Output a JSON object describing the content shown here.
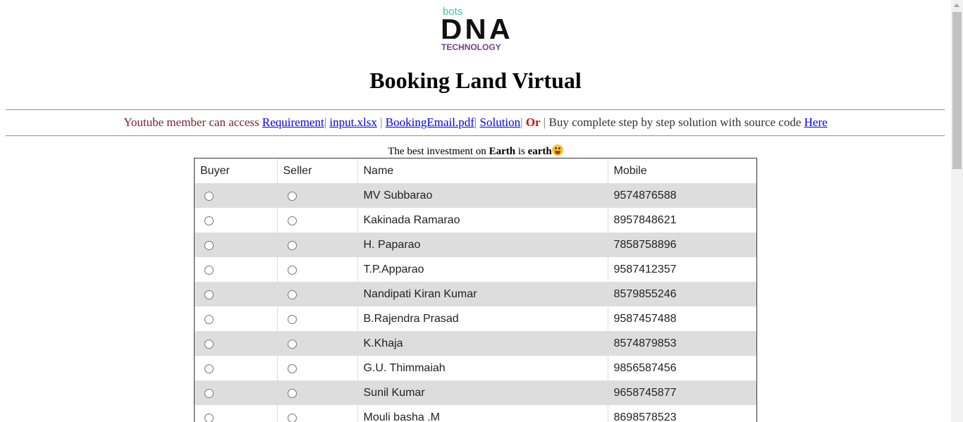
{
  "logo": {
    "top_text": "bots",
    "main_text": "DNA",
    "bottom_text": "TECHNOLOGY"
  },
  "title": "Booking Land Virtual",
  "linkbar": {
    "intro": "Youtube member can access",
    "links": [
      {
        "label": "Requirement"
      },
      {
        "label": "input.xlsx"
      },
      {
        "label": "BookingEmail.pdf"
      },
      {
        "label": "Solution"
      }
    ],
    "or_text": "Or",
    "buy_text": "Buy complete step by step solution with source code",
    "buy_link": "Here"
  },
  "tagline": {
    "prefix": "The best investment on",
    "bold1": "Earth",
    "middle": "is",
    "bold2": "earth"
  },
  "table": {
    "headers": {
      "buyer": "Buyer",
      "seller": "Seller",
      "name": "Name",
      "mobile": "Mobile"
    },
    "rows": [
      {
        "name": "MV Subbarao",
        "mobile": "9574876588"
      },
      {
        "name": "Kakinada Ramarao",
        "mobile": "8957848621"
      },
      {
        "name": "H. Paparao",
        "mobile": "7858758896"
      },
      {
        "name": "T.P.Apparao",
        "mobile": "9587412357"
      },
      {
        "name": "Nandipati Kiran Kumar",
        "mobile": "8579855246"
      },
      {
        "name": "B.Rajendra Prasad",
        "mobile": "9587457488"
      },
      {
        "name": "K.Khaja",
        "mobile": "8574879853"
      },
      {
        "name": "G.U. Thimmaiah",
        "mobile": "9856587456"
      },
      {
        "name": "Sunil Kumar",
        "mobile": "9658745877"
      },
      {
        "name": "Mouli basha .M",
        "mobile": "8698578523"
      }
    ]
  },
  "colors": {
    "row_shade": "#dddddd",
    "link": "#0000ee",
    "or_red": "#cc1111",
    "logo_teal": "#3cc3a5",
    "logo_purple": "#7a3d91"
  }
}
